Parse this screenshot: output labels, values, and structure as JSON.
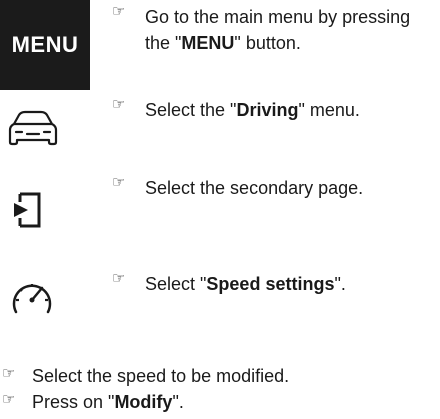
{
  "steps": [
    {
      "icon": "menu-key",
      "icon_label": "MENU",
      "bullet": "☞",
      "line1_a": "Go to the main menu by pressing",
      "line2_a": "the \"",
      "line2_bold": "MENU",
      "line2_b": "\" button."
    },
    {
      "icon": "car-icon",
      "bullet": "☞",
      "text_a": "Select the \"",
      "text_bold": "Driving",
      "text_b": "\" menu."
    },
    {
      "icon": "secondary-page-icon",
      "bullet": "☞",
      "text_a": "Select the secondary page.",
      "text_bold": "",
      "text_b": ""
    },
    {
      "icon": "speedometer-icon",
      "bullet": "☞",
      "text_a": "Select \"",
      "text_bold": "Speed settings",
      "text_b": "\"."
    }
  ],
  "bottom": [
    {
      "bullet": "☞",
      "text_a": "Select the speed to be modified.",
      "text_bold": "",
      "text_b": ""
    },
    {
      "bullet": "☞",
      "text_a": "Press on \"",
      "text_bold": "Modify",
      "text_b": "\"."
    }
  ]
}
